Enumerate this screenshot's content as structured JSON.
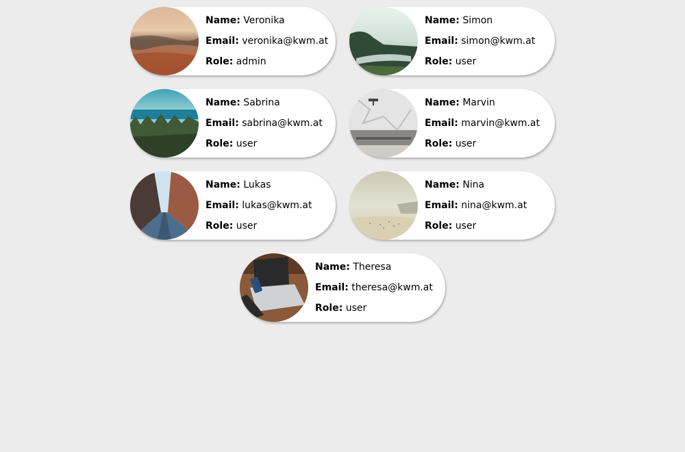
{
  "labels": {
    "name": "Name:",
    "email": "Email:",
    "role": "Role:"
  },
  "users": [
    {
      "name": "Veronika",
      "email": "veronika@kwm.at",
      "role": "admin",
      "image": "desert-landscape-photo"
    },
    {
      "name": "Simon",
      "email": "simon@kwm.at",
      "role": "user",
      "image": "foggy-river-valley-photo"
    },
    {
      "name": "Sabrina",
      "email": "sabrina@kwm.at",
      "role": "user",
      "image": "sea-and-forest-photo"
    },
    {
      "name": "Marvin",
      "email": "marvin@kwm.at",
      "role": "user",
      "image": "bench-and-white-wall-photo"
    },
    {
      "name": "Lukas",
      "email": "lukas@kwm.at",
      "role": "user",
      "image": "city-street-photo"
    },
    {
      "name": "Nina",
      "email": "nina@kwm.at",
      "role": "user",
      "image": "hazy-beach-photo"
    },
    {
      "name": "Theresa",
      "email": "theresa@kwm.at",
      "role": "user",
      "image": "laptop-and-phone-photo"
    }
  ]
}
